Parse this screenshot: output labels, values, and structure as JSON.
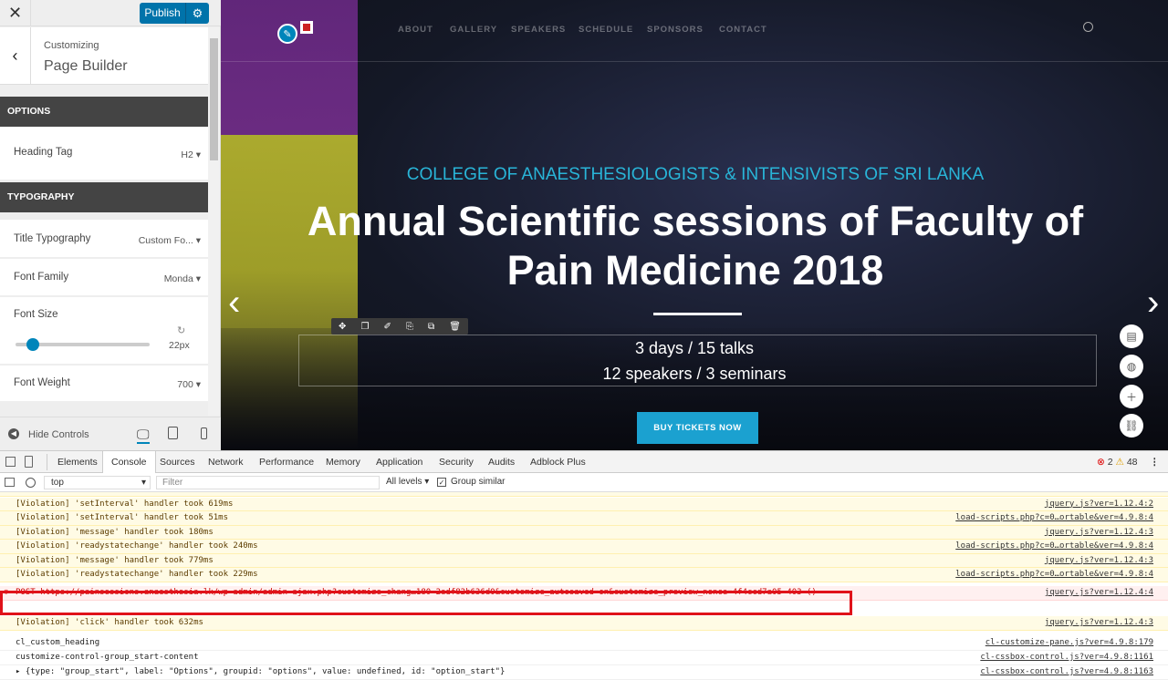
{
  "sidebar": {
    "close_icon": "close-icon",
    "publish_label": "Publish",
    "customizing_label": "Customizing",
    "section_title": "Page Builder",
    "options_heading": "OPTIONS",
    "heading_tag_label": "Heading Tag",
    "heading_tag_value": "H2",
    "typography_heading": "TYPOGRAPHY",
    "title_typography_label": "Title Typography",
    "title_typography_value": "Custom Fo...",
    "font_family_label": "Font Family",
    "font_family_value": "Monda",
    "font_size_label": "Font Size",
    "font_size_value": "22px",
    "font_size_fraction": 0.13,
    "font_weight_label": "Font Weight",
    "font_weight_value": "700",
    "hide_controls_label": "Hide Controls"
  },
  "preview": {
    "nav_items": [
      "ABOUT",
      "GALLERY",
      "SPEAKERS",
      "SCHEDULE",
      "SPONSORS",
      "CONTACT"
    ],
    "subtitle": "COLLEGE OF ANAESTHESIOLOGISTS & INTENSIVISTS OF SRI LANKA",
    "title": "Annual Scientific sessions of Faculty of Pain Medicine 2018",
    "info_line1": "3 days / 15 talks",
    "info_line2": "12 speakers / 3 seminars",
    "buy_button": "BUY TICKETS NOW",
    "accent_color": "#1ba1d0"
  },
  "devtools": {
    "tabs": [
      "Elements",
      "Console",
      "Sources",
      "Network",
      "Performance",
      "Memory",
      "Application",
      "Security",
      "Audits",
      "Adblock Plus"
    ],
    "active_tab": "Console",
    "error_count": "2",
    "warning_count": "48",
    "context": "top",
    "filter_placeholder": "Filter",
    "levels": "All levels",
    "group_similar": "Group similar",
    "logs": [
      {
        "msg": "[Violation] 'setInterval' handler took 619ms",
        "src": "jquery.js?ver=1.12.4:2",
        "type": "warn"
      },
      {
        "msg": "[Violation] 'setInterval' handler took 51ms",
        "src": "load-scripts.php?c=0…ortable&ver=4.9.8:4",
        "type": "warn"
      },
      {
        "msg": "[Violation] 'message' handler took 180ms",
        "src": "jquery.js?ver=1.12.4:3",
        "type": "warn"
      },
      {
        "msg": "[Violation] 'readystatechange' handler took 240ms",
        "src": "load-scripts.php?c=0…ortable&ver=4.9.8:4",
        "type": "warn"
      },
      {
        "msg": "[Violation] 'message' handler took 779ms",
        "src": "jquery.js?ver=1.12.4:3",
        "type": "warn"
      },
      {
        "msg": "[Violation] 'readystatechange' handler took 229ms",
        "src": "load-scripts.php?c=0…ortable&ver=4.9.8:4",
        "type": "warn"
      },
      {
        "msg": "POST https://painsessions.anaesthesia.lk/wp-admin/admin-ajax.php?customize_chang…180-2edf82b636d0&customize_autosaved=on&customize_preview_nonce=4f4ccd7a05 403 ()",
        "src": "jquery.js?ver=1.12.4:4",
        "type": "err"
      },
      {
        "msg": "[Violation] 'click' handler took 632ms",
        "src": "jquery.js?ver=1.12.4:3",
        "type": "warn"
      },
      {
        "msg": "cl_custom_heading",
        "src": "cl-customize-pane.js?ver=4.9.8:179",
        "type": "plain"
      },
      {
        "msg": "customize-control-group_start-content",
        "src": "cl-cssbox-control.js?ver=4.9.8:1161",
        "type": "plain"
      },
      {
        "msg": "▸ {type: \"group_start\", label: \"Options\", groupid: \"options\", value: undefined, id: \"option_start\"}",
        "src": "cl-cssbox-control.js?ver=4.9.8:1163",
        "type": "plain"
      }
    ]
  }
}
